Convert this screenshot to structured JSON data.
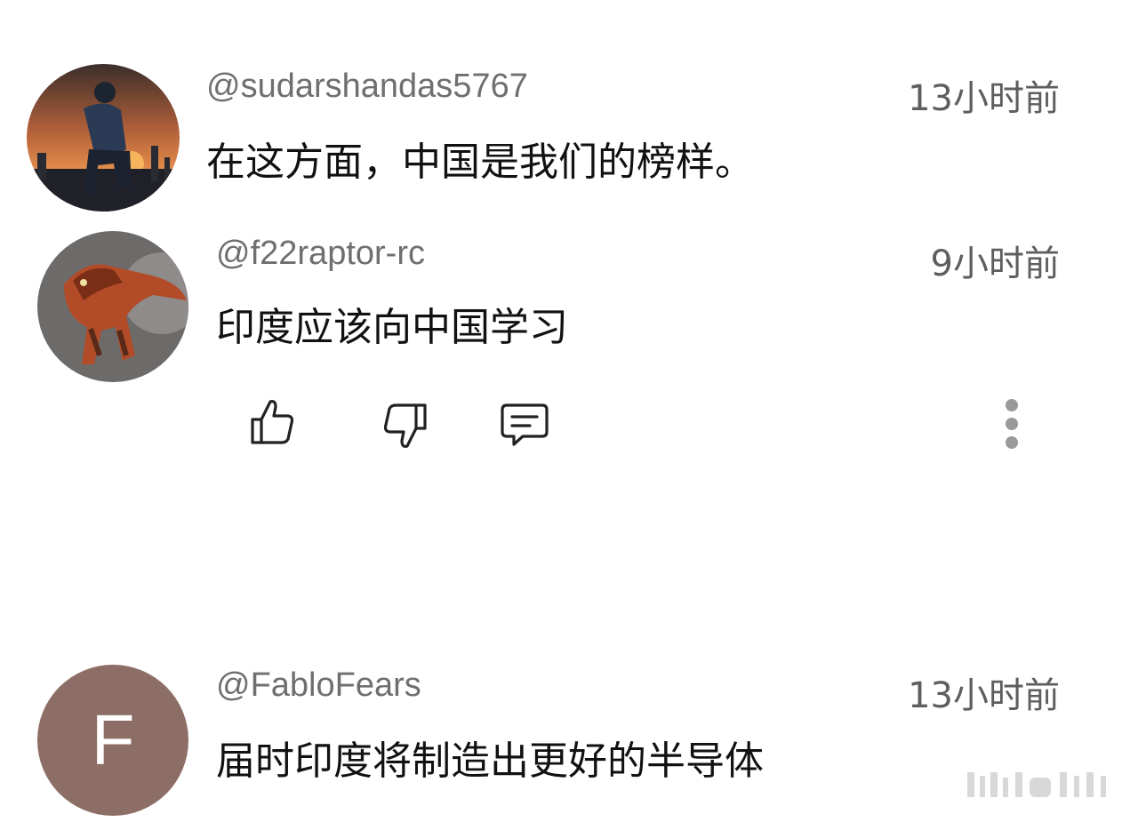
{
  "comments": [
    {
      "handle": "@sudarshandas5767",
      "time": "13小时前",
      "text": "在这方面，中国是我们的榜样。",
      "avatar_icon": "silhouette-sunset-avatar"
    },
    {
      "handle": "@f22raptor-rc",
      "time": "9小时前",
      "text": "印度应该向中国学习",
      "avatar_icon": "dinosaur-avatar"
    },
    {
      "handle": "@FabloFears",
      "time": "13小时前",
      "text": "届时印度将制造出更好的半导体",
      "avatar_letter": "F",
      "avatar_color": "#8d6e66"
    }
  ],
  "actions": {
    "like_icon": "thumbs-up-icon",
    "dislike_icon": "thumbs-down-icon",
    "reply_icon": "comment-icon",
    "more_icon": "more-vertical-icon"
  }
}
